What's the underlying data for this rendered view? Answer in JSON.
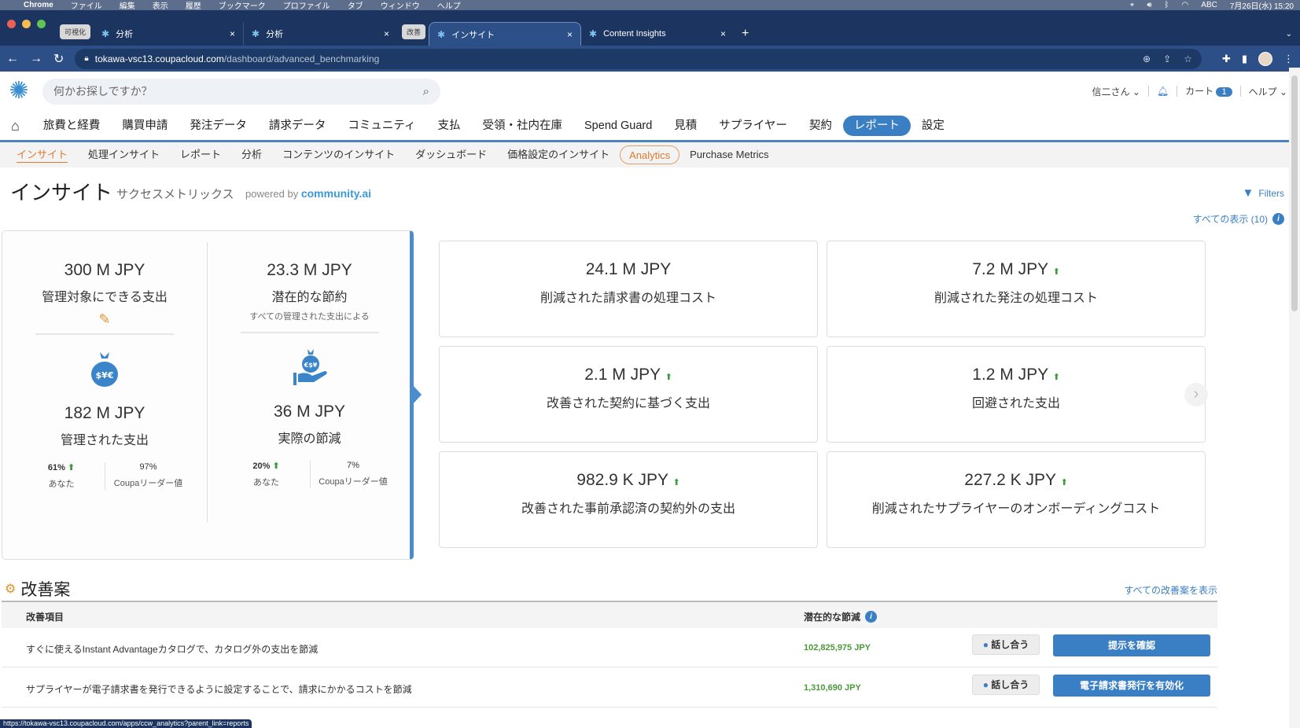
{
  "os_menubar": {
    "app": "Chrome",
    "items": [
      "ファイル",
      "編集",
      "表示",
      "履歴",
      "ブックマーク",
      "プロファイル",
      "タブ",
      "ウィンドウ",
      "ヘルプ"
    ],
    "input_mode": "ABC",
    "datetime": "7月26日(水) 15:20"
  },
  "browser": {
    "tabs": [
      {
        "group": "可視化",
        "title": "分析",
        "active": false
      },
      {
        "group": "",
        "title": "分析",
        "active": false
      },
      {
        "group": "改善",
        "title": "インサイト",
        "active": true
      },
      {
        "group": "",
        "title": "Content Insights",
        "active": false
      }
    ],
    "url_host": "tokawa-vsc13.coupacloud.com",
    "url_path": "/dashboard/advanced_benchmarking",
    "status_url": "https://tokawa-vsc13.coupacloud.com/apps/ccw_analytics?parent_link=reports"
  },
  "header": {
    "search_placeholder": "何かお探しですか？",
    "user": "信二さん",
    "cart_label": "カート",
    "cart_count": "1",
    "help_label": "ヘルプ"
  },
  "mainnav": {
    "items": [
      "旅費と経費",
      "購買申請",
      "発注データ",
      "請求データ",
      "コミュニティ",
      "支払",
      "受領・社内在庫",
      "Spend Guard",
      "見積",
      "サプライヤー",
      "契約",
      "レポート",
      "設定"
    ],
    "active": "レポート"
  },
  "subnav": {
    "items": [
      "インサイト",
      "処理インサイト",
      "レポート",
      "分析",
      "コンテンツのインサイト",
      "ダッシュボード",
      "価格設定のインサイト",
      "Analytics",
      "Purchase Metrics"
    ],
    "active": "インサイト",
    "hovered": "Analytics"
  },
  "page": {
    "title": "インサイト",
    "subtitle": "サクセスメトリックス",
    "powered_by": "powered by",
    "powered_brand": "community.ai",
    "filters_label": "Filters",
    "show_all_label": "すべての表示 (10)"
  },
  "summary": {
    "addressable": {
      "value": "300 M JPY",
      "label": "管理対象にできる支出"
    },
    "potential": {
      "value": "23.3 M JPY",
      "label": "潜在的な節約",
      "note": "すべての管理された支出による"
    },
    "managed": {
      "value": "182 M JPY",
      "label": "管理された支出",
      "you_value": "61%",
      "you_label": "あなた",
      "leader_value": "97%",
      "leader_label": "Coupaリーダー値"
    },
    "actual": {
      "value": "36 M JPY",
      "label": "実際の節減",
      "you_value": "20%",
      "you_label": "あなた",
      "leader_value": "7%",
      "leader_label": "Coupaリーダー値"
    }
  },
  "cards": [
    {
      "value": "24.1 M JPY",
      "label": "削減された請求書の処理コスト",
      "trend_up": false
    },
    {
      "value": "7.2 M JPY",
      "label": "削減された発注の処理コスト",
      "trend_up": true
    },
    {
      "value": "2.1 M JPY",
      "label": "改善された契約に基づく支出",
      "trend_up": true
    },
    {
      "value": "1.2 M JPY",
      "label": "回避された支出",
      "trend_up": true
    },
    {
      "value": "982.9 K JPY",
      "label": "改善された事前承認済の契約外の支出",
      "trend_up": true
    },
    {
      "value": "227.2 K JPY",
      "label": "削減されたサプライヤーのオンボーディングコスト",
      "trend_up": true
    }
  ],
  "improvements": {
    "title": "改善案",
    "show_all": "すべての改善案を表示",
    "col_item": "改善項目",
    "col_savings": "潜在的な節減",
    "rows": [
      {
        "text": "すぐに使えるInstant Advantageカタログで、カタログ外の支出を節減",
        "amount": "102,825,975 JPY",
        "discuss": "話し合う",
        "action": "提示を確認"
      },
      {
        "text": "サプライヤーが電子請求書を発行できるように設定することで、請求にかかるコストを節減",
        "amount": "1,310,690 JPY",
        "discuss": "話し合う",
        "action": "電子請求書発行を有効化"
      }
    ]
  },
  "colors": {
    "accent": "#3a7fc4",
    "active_subnav": "#e07a2e",
    "positive": "#3a9a3a",
    "browser_chrome": "#1b3560"
  }
}
